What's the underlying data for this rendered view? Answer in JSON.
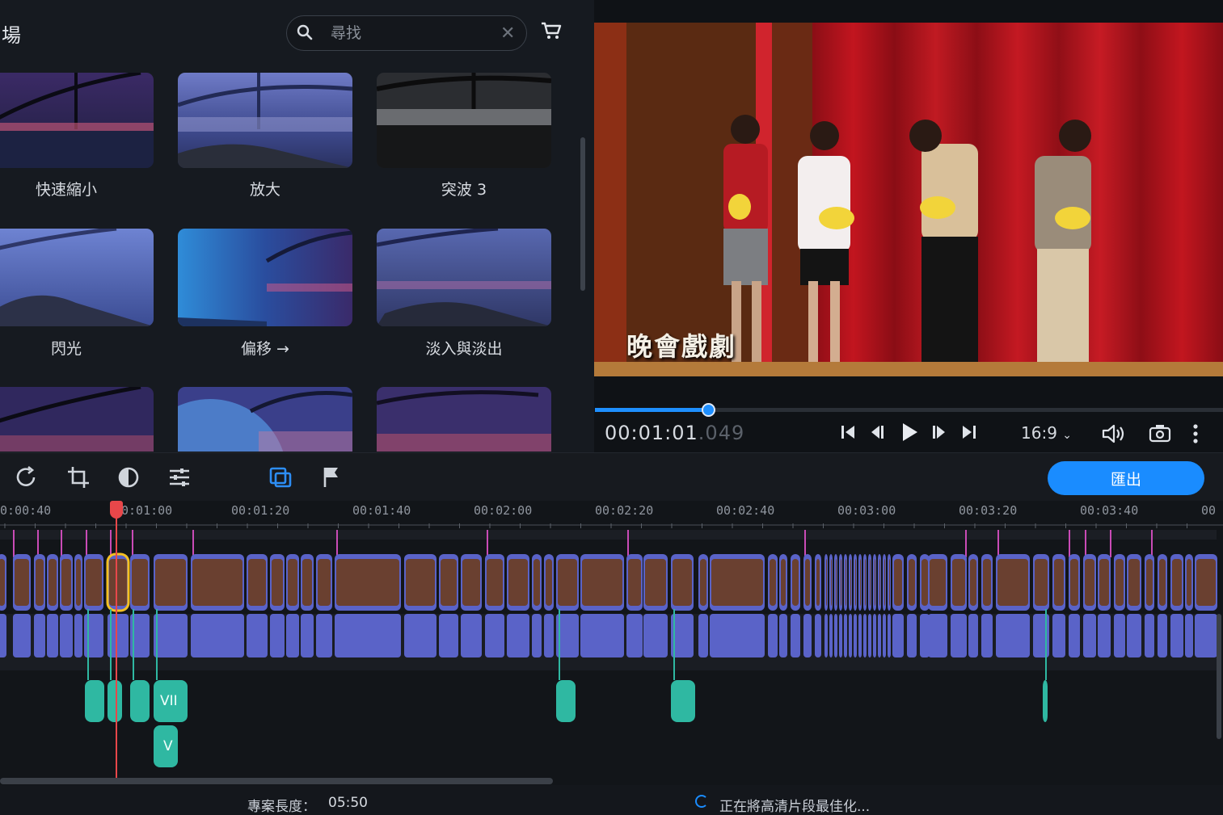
{
  "transitions_panel": {
    "title": "場",
    "search_placeholder": "尋找",
    "tiles": [
      {
        "label": "快速縮小",
        "icon": "city-bridge-thumbnail"
      },
      {
        "label": "放大",
        "icon": "city-bridge-thumbnail"
      },
      {
        "label": "突波 3",
        "icon": "city-bridge-thumbnail"
      },
      {
        "label": "閃光",
        "icon": "city-bridge-thumbnail"
      },
      {
        "label": "偏移 →",
        "icon": "city-bridge-thumbnail"
      },
      {
        "label": "淡入與淡出",
        "icon": "city-bridge-thumbnail"
      }
    ]
  },
  "preview": {
    "caption": "晚會戲劇",
    "timecode_main": "00:01:01",
    "timecode_ms": ".049",
    "aspect_ratio": "16:9",
    "progress_fraction": 0.18
  },
  "toolbar": {
    "export_label": "匯出"
  },
  "timeline": {
    "ticks": [
      "0:00:40",
      "0:01:00",
      "00:01:20",
      "00:01:40",
      "00:02:00",
      "00:02:20",
      "00:02:40",
      "00:03:00",
      "00:03:20",
      "00:03:40",
      "00"
    ],
    "audio_clip_labels": [
      "VII",
      "V"
    ]
  },
  "statusbar": {
    "project_length_label": "專案長度：",
    "project_length_value": "05:50",
    "status_text": "正在將高清片段最佳化..."
  },
  "colors": {
    "accent": "#1a8cff",
    "playhead": "#e8474a",
    "video_track": "#5a63c8",
    "audio_track": "#2fb8a2",
    "marker": "#c94bb6"
  }
}
